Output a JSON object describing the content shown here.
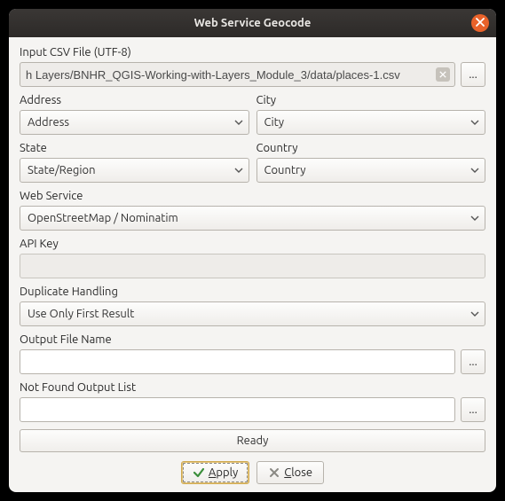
{
  "window": {
    "title": "Web Service Geocode"
  },
  "labels": {
    "input_csv": "Input CSV File (UTF-8)",
    "address": "Address",
    "city": "City",
    "state": "State",
    "country": "Country",
    "web_service": "Web Service",
    "api_key": "API Key",
    "duplicate": "Duplicate Handling",
    "output_file": "Output File Name",
    "not_found": "Not Found Output List"
  },
  "values": {
    "input_csv": "h Layers/BNHR_QGIS-Working-with-Layers_Module_3/data/places-1.csv",
    "address_combo": "Address",
    "city_combo": "City",
    "state_combo": "State/Region",
    "country_combo": "Country",
    "web_service_combo": "OpenStreetMap / Nominatim",
    "api_key": "",
    "duplicate_combo": "Use Only First Result",
    "output_file": "",
    "not_found": ""
  },
  "status": {
    "ready": "Ready"
  },
  "buttons": {
    "browse": "...",
    "apply_prefix": "",
    "apply_u": "A",
    "apply_rest": "pply",
    "close_prefix": "",
    "close_u": "C",
    "close_rest": "lose"
  }
}
